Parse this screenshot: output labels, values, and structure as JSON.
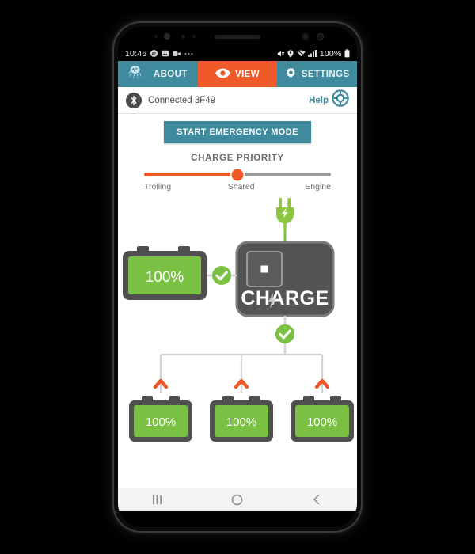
{
  "status_bar": {
    "time": "10:46",
    "battery_percent": "100%",
    "icons": [
      "message-icon",
      "image-icon",
      "video-icon",
      "more-dots-icon",
      "mute-icon",
      "location-icon",
      "wifi-icon",
      "signal-icon",
      "battery-icon"
    ]
  },
  "tabs": [
    {
      "label": "ABOUT",
      "icon": "octopus-logo-icon",
      "active": false
    },
    {
      "label": "VIEW",
      "icon": "eye-icon",
      "active": true
    },
    {
      "label": "SETTINGS",
      "icon": "gear-icon",
      "active": false
    }
  ],
  "connection": {
    "icon": "bluetooth-icon",
    "status_text": "Connected  3F49",
    "help_label": "Help",
    "help_icon": "life-ring-icon"
  },
  "emergency": {
    "button_label": "START EMERGENCY MODE"
  },
  "charge_priority": {
    "title": "CHARGE PRIORITY",
    "labels": {
      "left": "Trolling",
      "middle": "Shared",
      "right": "Engine"
    },
    "value_percent": 50
  },
  "diagram": {
    "plug_icon": "power-plug-icon",
    "device": {
      "label": "CHARGE",
      "indicator_icon": "status-led-icon"
    },
    "start_battery": {
      "level_label": "100%",
      "status_icon": "check-circle-icon"
    },
    "bus_status_icon": "check-circle-icon",
    "house_batteries": [
      {
        "level_label": "100%",
        "arrow_icon": "chevron-up-icon"
      },
      {
        "level_label": "100%",
        "arrow_icon": "chevron-up-icon"
      },
      {
        "level_label": "100%",
        "arrow_icon": "chevron-up-icon"
      }
    ]
  },
  "nav_bar": {
    "recents_icon": "recents-icon",
    "home_icon": "home-icon",
    "back_icon": "back-icon"
  },
  "colors": {
    "teal": "#3f8a9d",
    "orange": "#f05a28",
    "green": "#7ac143",
    "dark_gray": "#4a4a4a",
    "light_gray": "#c9c9c9"
  }
}
